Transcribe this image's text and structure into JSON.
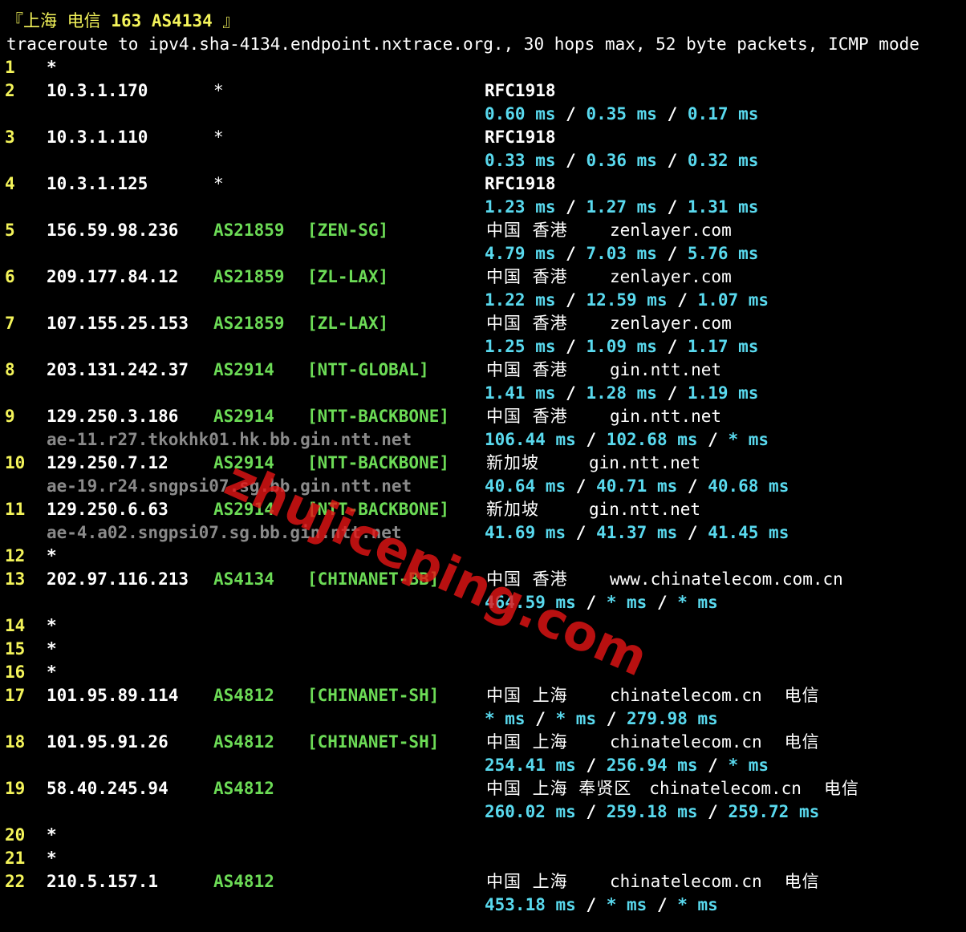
{
  "header": {
    "title_prefix": "『上海 电信 ",
    "title_bold": "163 AS4134",
    "title_suffix": " 』",
    "command": "traceroute to ipv4.sha-4134.endpoint.nxtrace.org., 30 hops max, 52 byte packets, ICMP mode"
  },
  "hops": [
    {
      "num": "1",
      "ip": "*"
    },
    {
      "num": "2",
      "ip": "10.3.1.170",
      "asn": "*",
      "geo": "RFC1918",
      "rtt": [
        "0.60 ms",
        "0.35 ms",
        "0.17 ms"
      ]
    },
    {
      "num": "3",
      "ip": "10.3.1.110",
      "asn": "*",
      "geo": "RFC1918",
      "rtt": [
        "0.33 ms",
        "0.36 ms",
        "0.32 ms"
      ]
    },
    {
      "num": "4",
      "ip": "10.3.1.125",
      "asn": "*",
      "geo": "RFC1918",
      "rtt": [
        "1.23 ms",
        "1.27 ms",
        "1.31 ms"
      ]
    },
    {
      "num": "5",
      "ip": "156.59.98.236",
      "asn": "AS21859",
      "tag": "[ZEN-SG]",
      "geo": "中国 香港",
      "domain": "zenlayer.com",
      "rtt": [
        "4.79 ms",
        "7.03 ms",
        "5.76 ms"
      ]
    },
    {
      "num": "6",
      "ip": "209.177.84.12",
      "asn": "AS21859",
      "tag": "[ZL-LAX]",
      "geo": "中国 香港",
      "domain": "zenlayer.com",
      "rtt": [
        "1.22 ms",
        "12.59 ms",
        "1.07 ms"
      ]
    },
    {
      "num": "7",
      "ip": "107.155.25.153",
      "asn": "AS21859",
      "tag": "[ZL-LAX]",
      "geo": "中国 香港",
      "domain": "zenlayer.com",
      "rtt": [
        "1.25 ms",
        "1.09 ms",
        "1.17 ms"
      ]
    },
    {
      "num": "8",
      "ip": "203.131.242.37",
      "asn": "AS2914",
      "tag": "[NTT-GLOBAL]",
      "geo": "中国 香港",
      "domain": "gin.ntt.net",
      "rtt": [
        "1.41 ms",
        "1.28 ms",
        "1.19 ms"
      ]
    },
    {
      "num": "9",
      "ip": "129.250.3.186",
      "asn": "AS2914",
      "tag": "[NTT-BACKBONE]",
      "geo": "中国 香港",
      "domain": "gin.ntt.net",
      "host": "ae-11.r27.tkokhk01.hk.bb.gin.ntt.net",
      "rtt": [
        "106.44 ms",
        "102.68 ms",
        "* ms"
      ]
    },
    {
      "num": "10",
      "ip": "129.250.7.12",
      "asn": "AS2914",
      "tag": "[NTT-BACKBONE]",
      "geo": "新加坡",
      "domain": "gin.ntt.net",
      "host": "ae-19.r24.sngpsi07.sg.bb.gin.ntt.net",
      "rtt": [
        "40.64 ms",
        "40.71 ms",
        "40.68 ms"
      ]
    },
    {
      "num": "11",
      "ip": "129.250.6.63",
      "asn": "AS2914",
      "tag": "[NTT-BACKBONE]",
      "geo": "新加坡",
      "domain": "gin.ntt.net",
      "host": "ae-4.a02.sngpsi07.sg.bb.gin.ntt.net",
      "rtt": [
        "41.69 ms",
        "41.37 ms",
        "41.45 ms"
      ]
    },
    {
      "num": "12",
      "ip": "*"
    },
    {
      "num": "13",
      "ip": "202.97.116.213",
      "asn": "AS4134",
      "tag": "[CHINANET-BB]",
      "geo": "中国 香港",
      "domain": "www.chinatelecom.com.cn",
      "rtt": [
        "464.59 ms",
        "* ms",
        "* ms"
      ]
    },
    {
      "num": "14",
      "ip": "*"
    },
    {
      "num": "15",
      "ip": "*"
    },
    {
      "num": "16",
      "ip": "*"
    },
    {
      "num": "17",
      "ip": "101.95.89.114",
      "asn": "AS4812",
      "tag": "[CHINANET-SH]",
      "geo": "中国 上海",
      "domain": "chinatelecom.cn",
      "isp": "电信",
      "rtt": [
        "* ms",
        "* ms",
        "279.98 ms"
      ]
    },
    {
      "num": "18",
      "ip": "101.95.91.26",
      "asn": "AS4812",
      "tag": "[CHINANET-SH]",
      "geo": "中国 上海",
      "domain": "chinatelecom.cn",
      "isp": "电信",
      "rtt": [
        "254.41 ms",
        "256.94 ms",
        "* ms"
      ]
    },
    {
      "num": "19",
      "ip": "58.40.245.94",
      "asn": "AS4812",
      "geo": "中国 上海 奉贤区",
      "domain": "chinatelecom.cn",
      "isp": "电信",
      "rtt": [
        "260.02 ms",
        "259.18 ms",
        "259.72 ms"
      ]
    },
    {
      "num": "20",
      "ip": "*"
    },
    {
      "num": "21",
      "ip": "*"
    },
    {
      "num": "22",
      "ip": "210.5.157.1",
      "asn": "AS4812",
      "geo": "中国 上海",
      "domain": "chinatelecom.cn",
      "isp": "电信",
      "rtt": [
        "453.18 ms",
        "* ms",
        "* ms"
      ]
    }
  ],
  "separator": " / ",
  "watermark": "zhujiceping.com",
  "colors": {
    "background": "#000000",
    "hop_number": "#f4f45a",
    "ip": "#ffffff",
    "asn": "#6cdb56",
    "rtt": "#59d9ee",
    "hostname": "#8a8a8a",
    "watermark": "#e61414"
  }
}
